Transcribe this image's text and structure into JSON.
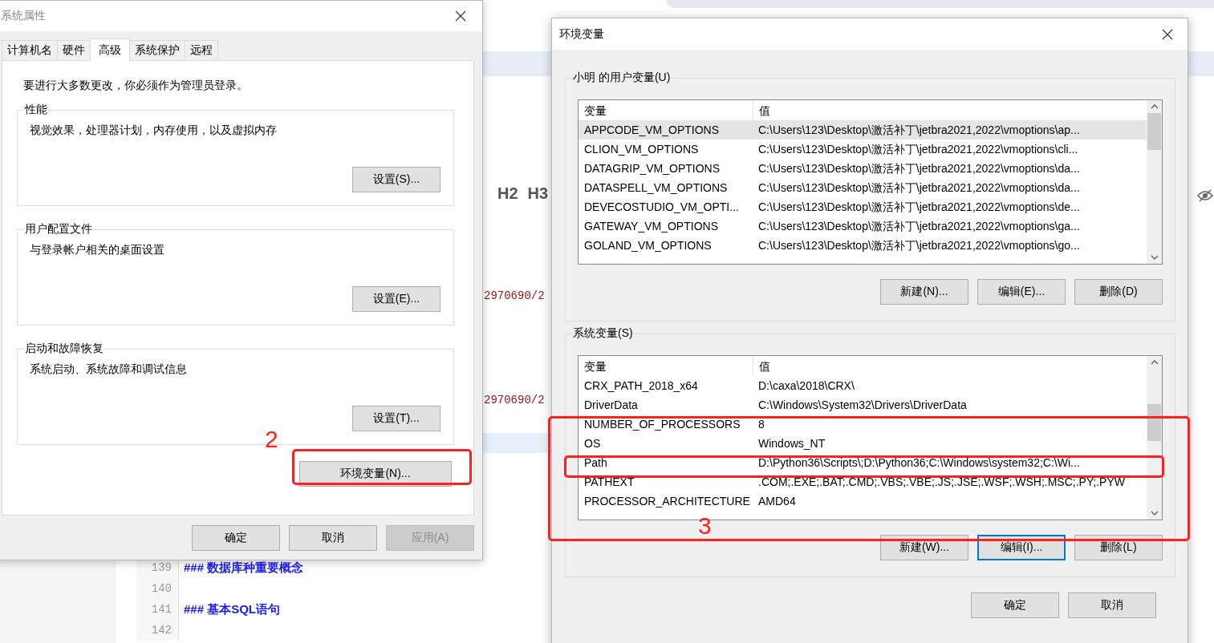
{
  "editor": {
    "toolbar": [
      "H2",
      "H3"
    ],
    "red_texts": [
      "2970690/2",
      "2970690/2"
    ],
    "lines": [
      {
        "number": "139",
        "text": "### 数据库种重要概念"
      },
      {
        "number": "140"
      },
      {
        "number": "141",
        "text": "### 基本SQL语句"
      },
      {
        "number": "142"
      }
    ]
  },
  "system_properties": {
    "title": "系统属性",
    "tabs": [
      {
        "label": "计算机名",
        "selected": false
      },
      {
        "label": "硬件",
        "selected": false
      },
      {
        "label": "高级",
        "selected": true
      },
      {
        "label": "系统保护",
        "selected": false
      },
      {
        "label": "远程",
        "selected": false
      }
    ],
    "notice": "要进行大多数更改，你必须作为管理员登录。",
    "groups": [
      {
        "title": "性能",
        "description": "视觉效果，处理器计划，内存使用，以及虚拟内存",
        "button": "设置(S)..."
      },
      {
        "title": "用户配置文件",
        "description": "与登录帐户相关的桌面设置",
        "button": "设置(E)..."
      },
      {
        "title": "启动和故障恢复",
        "description": "系统启动、系统故障和调试信息",
        "button": "设置(T)..."
      }
    ],
    "env_button": "环境变量(N)...",
    "buttons": [
      {
        "label": "确定",
        "disabled": false
      },
      {
        "label": "取消",
        "disabled": false
      },
      {
        "label": "应用(A)",
        "disabled": true
      }
    ]
  },
  "environment_variables": {
    "title": "环境变量",
    "user_vars": {
      "title": "小明 的用户变量(U)",
      "columns": [
        "变量",
        "值"
      ],
      "rows": [
        {
          "name": "APPCODE_VM_OPTIONS",
          "value": "C:\\Users\\123\\Desktop\\激活补丁\\jetbra2021,2022\\vmoptions\\ap...",
          "selected": true
        },
        {
          "name": "CLION_VM_OPTIONS",
          "value": "C:\\Users\\123\\Desktop\\激活补丁\\jetbra2021,2022\\vmoptions\\cli...",
          "selected": false
        },
        {
          "name": "DATAGRIP_VM_OPTIONS",
          "value": "C:\\Users\\123\\Desktop\\激活补丁\\jetbra2021,2022\\vmoptions\\da...",
          "selected": false
        },
        {
          "name": "DATASPELL_VM_OPTIONS",
          "value": "C:\\Users\\123\\Desktop\\激活补丁\\jetbra2021,2022\\vmoptions\\da...",
          "selected": false
        },
        {
          "name": "DEVECOSTUDIO_VM_OPTI...",
          "value": "C:\\Users\\123\\Desktop\\激活补丁\\jetbra2021,2022\\vmoptions\\de...",
          "selected": false
        },
        {
          "name": "GATEWAY_VM_OPTIONS",
          "value": "C:\\Users\\123\\Desktop\\激活补丁\\jetbra2021,2022\\vmoptions\\ga...",
          "selected": false
        },
        {
          "name": "GOLAND_VM_OPTIONS",
          "value": "C:\\Users\\123\\Desktop\\激活补丁\\jetbra2021,2022\\vmoptions\\go...",
          "selected": false
        }
      ],
      "buttons": [
        {
          "label": "新建(N)...",
          "focused": false
        },
        {
          "label": "编辑(E)...",
          "focused": false
        },
        {
          "label": "删除(D)",
          "focused": false
        }
      ]
    },
    "system_vars": {
      "title": "系统变量(S)",
      "columns": [
        "变量",
        "值"
      ],
      "rows": [
        {
          "name": "CRX_PATH_2018_x64",
          "value": "D:\\caxa\\2018\\CRX\\",
          "selected": false
        },
        {
          "name": "DriverData",
          "value": "C:\\Windows\\System32\\Drivers\\DriverData",
          "selected": false
        },
        {
          "name": "NUMBER_OF_PROCESSORS",
          "value": "8",
          "selected": false
        },
        {
          "name": "OS",
          "value": "Windows_NT",
          "selected": false
        },
        {
          "name": "Path",
          "value": "D:\\Python36\\Scripts\\;D:\\Python36;C:\\Windows\\system32;C:\\Wi...",
          "selected": false
        },
        {
          "name": "PATHEXT",
          "value": ".COM;.EXE;.BAT;.CMD;.VBS;.VBE;.JS;.JSE;.WSF;.WSH;.MSC;.PY;.PYW",
          "selected": false
        },
        {
          "name": "PROCESSOR_ARCHITECTURE",
          "value": "AMD64",
          "selected": false
        }
      ],
      "buttons": [
        {
          "label": "新建(W)...",
          "focused": false
        },
        {
          "label": "编辑(I)...",
          "focused": true
        },
        {
          "label": "删除(L)",
          "focused": false
        }
      ]
    },
    "buttons": [
      {
        "label": "确定"
      },
      {
        "label": "取消"
      }
    ]
  },
  "annotations": [
    {
      "label": "2"
    },
    {
      "label": "3"
    }
  ]
}
